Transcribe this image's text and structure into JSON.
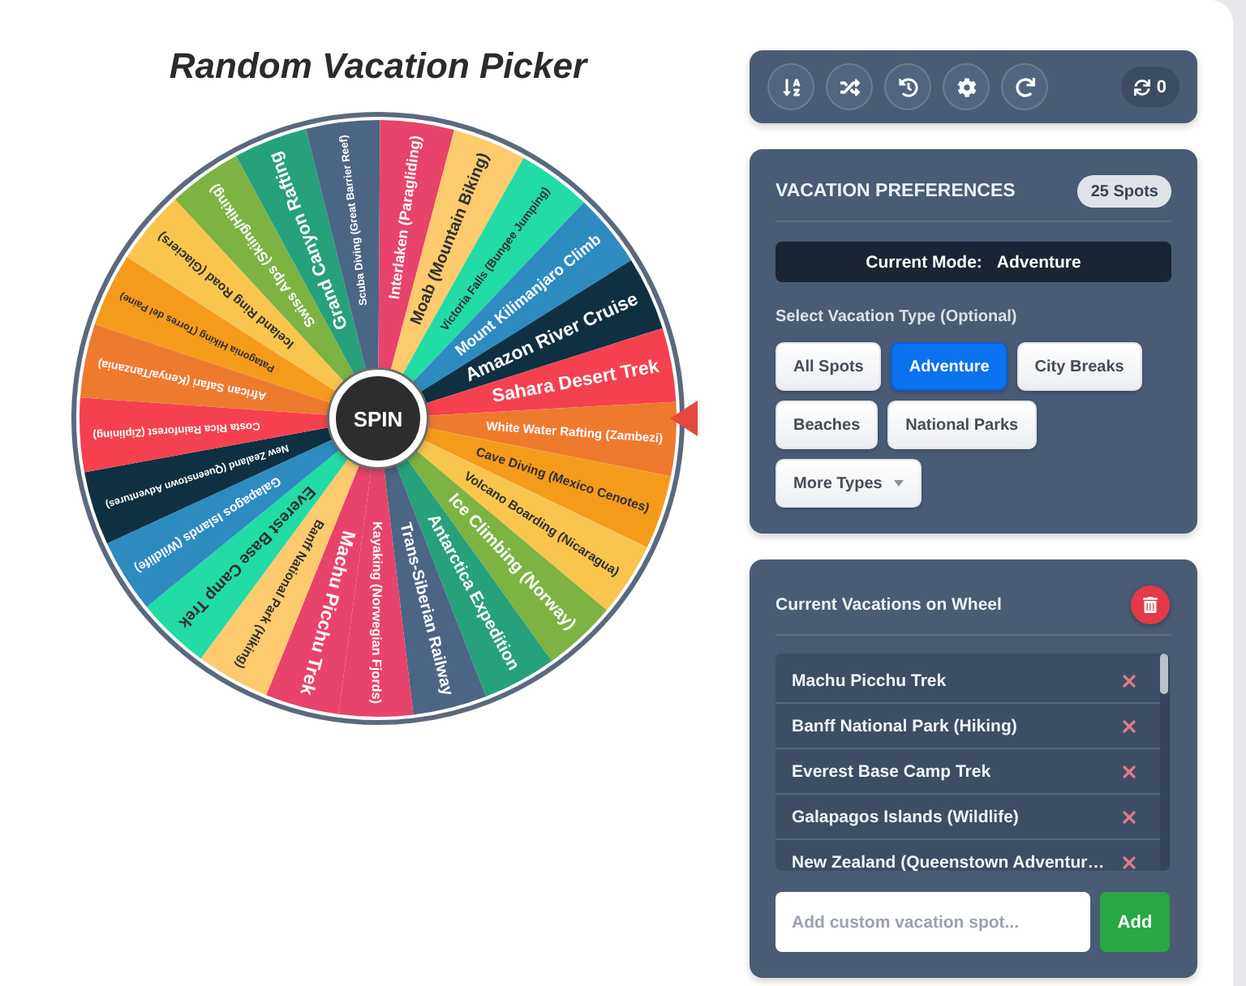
{
  "title": "Random Vacation Picker",
  "wheel": {
    "spin_label": "SPIN",
    "segments": [
      {
        "label": "Machu Picchu Trek",
        "color": "#e8436a"
      },
      {
        "label": "Banff National Park (Hiking)",
        "color": "#fdcb6e"
      },
      {
        "label": "Everest Base Camp Trek",
        "color": "#22dba5"
      },
      {
        "label": "Galapagos Islands (Wildlife)",
        "color": "#2e8bc0"
      },
      {
        "label": "New Zealand (Queenstown Adventures)",
        "color": "#0f3042"
      },
      {
        "label": "Costa Rica Rainforest (Ziplining)",
        "color": "#f5414f"
      },
      {
        "label": "African Safari (Kenya/Tanzania)",
        "color": "#ee7a2e"
      },
      {
        "label": "Patagonia Hiking (Torres del Paine)",
        "color": "#f59b1c"
      },
      {
        "label": "Iceland Ring Road (Glaciers)",
        "color": "#f9c54f"
      },
      {
        "label": "Swiss Alps (Skiing/Hiking)",
        "color": "#7cb342"
      },
      {
        "label": "Grand Canyon Rafting",
        "color": "#26a17b"
      },
      {
        "label": "Scuba Diving (Great Barrier Reef)",
        "color": "#4b6584"
      },
      {
        "label": "Interlaken (Paragliding)",
        "color": "#e8436a"
      },
      {
        "label": "Moab (Mountain Biking)",
        "color": "#fdcb6e"
      },
      {
        "label": "Victoria Falls (Bungee Jumping)",
        "color": "#22dba5"
      },
      {
        "label": "Mount Kilimanjaro Climb",
        "color": "#2e8bc0"
      },
      {
        "label": "Amazon River Cruise",
        "color": "#0f3042"
      },
      {
        "label": "Sahara Desert Trek",
        "color": "#f5414f"
      },
      {
        "label": "White Water Rafting (Zambezi)",
        "color": "#ee7a2e"
      },
      {
        "label": "Cave Diving (Mexico Cenotes)",
        "color": "#f59b1c"
      },
      {
        "label": "Volcano Boarding (Nicaragua)",
        "color": "#f9c54f"
      },
      {
        "label": "Ice Climbing (Norway)",
        "color": "#7cb342"
      },
      {
        "label": "Antarctica Expedition",
        "color": "#26a17b"
      },
      {
        "label": "Trans-Siberian Railway",
        "color": "#4b6584"
      },
      {
        "label": "Kayaking (Norwegian Fjords)",
        "color": "#e8436a"
      }
    ]
  },
  "toolbar": {
    "spin_count": "0"
  },
  "preferences": {
    "title": "VACATION PREFERENCES",
    "count_badge": "25 Spots",
    "current_mode": {
      "label": "Current Mode:",
      "value": "Adventure"
    },
    "type_prompt": "Select Vacation Type (Optional)",
    "types": [
      {
        "label": "All Spots",
        "kind": "button",
        "selected": false
      },
      {
        "label": "Adventure",
        "kind": "button",
        "selected": true
      },
      {
        "label": "City Breaks",
        "kind": "button",
        "selected": false
      },
      {
        "label": "Beaches",
        "kind": "button",
        "selected": false
      },
      {
        "label": "National Parks",
        "kind": "button",
        "selected": false
      },
      {
        "label": "More Types",
        "kind": "dropdown",
        "selected": false
      }
    ]
  },
  "vacations": {
    "title": "Current Vacations on Wheel",
    "items": [
      "Machu Picchu Trek",
      "Banff National Park (Hiking)",
      "Everest Base Camp Trek",
      "Galapagos Islands (Wildlife)",
      "New Zealand (Queenstown Adventur…"
    ],
    "input": {
      "placeholder": "Add custom vacation spot..."
    },
    "add_button": "Add"
  }
}
